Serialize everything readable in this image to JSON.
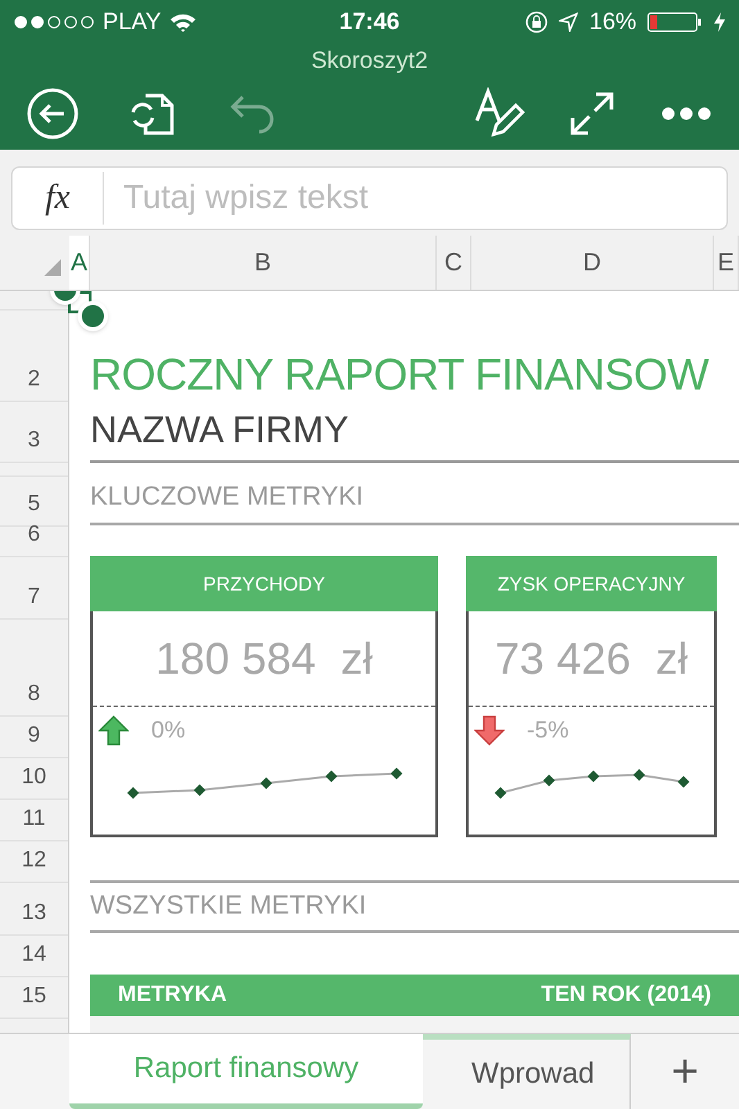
{
  "status_bar": {
    "carrier": "PLAY",
    "time": "17:46",
    "battery": "16%"
  },
  "window": {
    "title": "Skoroszyt2"
  },
  "toolbar": {
    "undo_disabled": true
  },
  "formula_bar": {
    "fx": "fx",
    "placeholder": "Tutaj wpisz tekst"
  },
  "columns": [
    {
      "label": "A",
      "selected": true
    },
    {
      "label": "B",
      "selected": false
    },
    {
      "label": "C",
      "selected": false
    },
    {
      "label": "D",
      "selected": false
    },
    {
      "label": "E",
      "selected": false
    }
  ],
  "rows": [
    "2",
    "3",
    "5",
    "6",
    "7",
    "8",
    "9",
    "10",
    "11",
    "12",
    "13",
    "14",
    "15"
  ],
  "sheet": {
    "title": "ROCZNY RAPORT FINANSOW",
    "subtitle": "NAZWA FIRMY",
    "section_1": "KLUCZOWE METRYKI",
    "cards": [
      {
        "title": "PRZYCHODY",
        "value": "180 584",
        "currency": "zł",
        "rising": true,
        "change": "0%"
      },
      {
        "title": "ZYSK OPERACYJNY",
        "value": "73 426",
        "currency": "zł",
        "rising": false,
        "change": "-5%"
      }
    ],
    "section_2": "WSZYSTKIE METRYKI",
    "table_columns": [
      "METRYKA",
      "TEN ROK (2014)"
    ]
  },
  "tabs": [
    {
      "label": "Raport finansowy",
      "selected": true
    },
    {
      "label": "Wprowad",
      "selected": false
    }
  ],
  "add_tab": "+"
}
